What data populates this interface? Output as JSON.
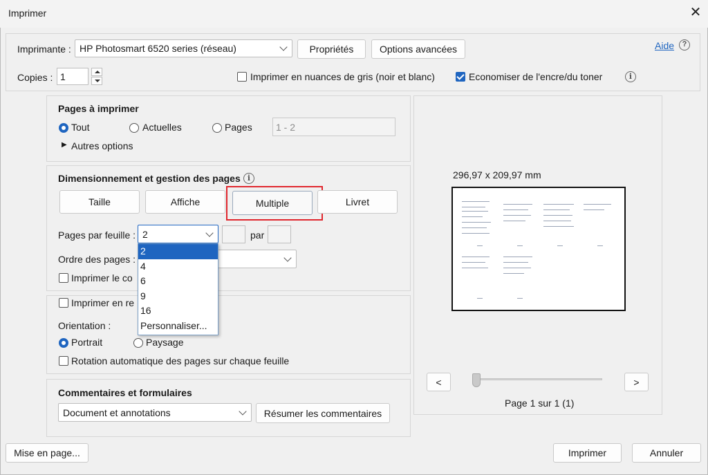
{
  "window": {
    "title": "Imprimer"
  },
  "header": {
    "printer_label": "Imprimante :",
    "printer_value": "HP Photosmart 6520 series (réseau)",
    "properties_button": "Propriétés",
    "advanced_button": "Options avancées",
    "help_link": "Aide",
    "copies_label": "Copies :",
    "copies_value": "1",
    "grayscale_label": "Imprimer en nuances de gris (noir et blanc)",
    "grayscale_checked": false,
    "save_ink_label": "Economiser de l'encre/du toner",
    "save_ink_checked": true
  },
  "pages_to_print": {
    "title": "Pages à imprimer",
    "options": [
      "Tout",
      "Actuelles",
      "Pages"
    ],
    "selected": "Tout",
    "range_value": "1 - 2",
    "more_options": "Autres options"
  },
  "sizing": {
    "title": "Dimensionnement et gestion des pages",
    "tabs": [
      "Taille",
      "Affiche",
      "Multiple",
      "Livret"
    ],
    "active_tab": "Multiple",
    "highlight_color": "#e0262d",
    "pages_per_sheet_label": "Pages par feuille :",
    "pages_per_sheet_value": "2",
    "pages_per_sheet_options": [
      "2",
      "4",
      "6",
      "9",
      "16",
      "Personnaliser..."
    ],
    "par_label": "par",
    "page_order_label": "Ordre des pages :",
    "print_border_label": "Imprimer le co"
  },
  "orientation_group": {
    "print_label": "Imprimer en re",
    "orientation_label": "Orientation :",
    "options": [
      "Portrait",
      "Paysage"
    ],
    "selected": "Portrait",
    "auto_rotate_label": "Rotation automatique des pages sur chaque feuille"
  },
  "comments": {
    "title": "Commentaires et formulaires",
    "value": "Document et annotations",
    "summarize_button": "Résumer les commentaires"
  },
  "preview": {
    "dimensions": "296,97 x 209,97 mm",
    "prev_button": "<",
    "next_button": ">",
    "page_status": "Page 1 sur 1 (1)"
  },
  "footer": {
    "page_setup_button": "Mise en page...",
    "print_button": "Imprimer",
    "cancel_button": "Annuler"
  },
  "colors": {
    "accent": "#1f65c0",
    "link": "#1f65c0"
  }
}
